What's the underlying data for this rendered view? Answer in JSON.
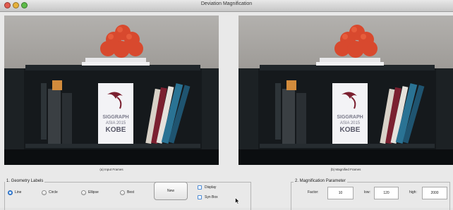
{
  "window": {
    "title": "Deviation Magnification",
    "controls": [
      "close-icon",
      "minimize-icon",
      "maximize-icon"
    ]
  },
  "scene": {
    "book_title_lines": [
      "SIGGRAPH",
      "ASIA 2015",
      "KOBE"
    ],
    "colors": {
      "wall": "#aaa7a4",
      "shelf": "#15191c",
      "toy": "#d8492e",
      "book_blue": "#2a7394",
      "book_red": "#7b2030"
    }
  },
  "captions": {
    "input": "(a) Input Frames",
    "magnified": "(b) Magnified Frames"
  },
  "geometry_panel": {
    "title": "1. Geometry Labels",
    "options": [
      {
        "label": "Line",
        "selected": true
      },
      {
        "label": "Circle",
        "selected": false
      },
      {
        "label": "Ellipse",
        "selected": false
      },
      {
        "label": "Best",
        "selected": false
      }
    ],
    "new_button": "New",
    "display_label": "Display",
    "syn_box_label": "Syn Box",
    "display_checked": false,
    "syn_box_checked": false
  },
  "magnification_panel": {
    "title": "2. Magnification Parameter",
    "factor_label": "Factor:",
    "factor_value": "10",
    "low_label": "low:",
    "low_value": "120",
    "high_label": "high:",
    "high_value": "2000"
  },
  "accent_color": "#3a86d8"
}
